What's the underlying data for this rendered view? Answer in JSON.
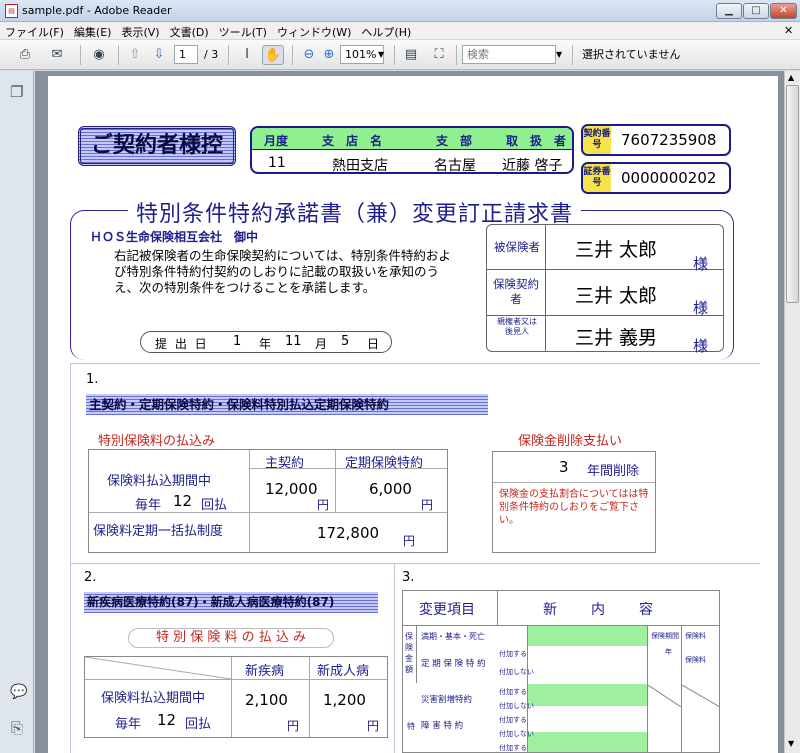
{
  "window": {
    "title": "sample.pdf - Adobe Reader",
    "min": "▁",
    "max": "□",
    "close": "✕"
  },
  "menu": [
    "ファイル(F)",
    "編集(E)",
    "表示(V)",
    "文書(D)",
    "ツール(T)",
    "ウィンドウ(W)",
    "ヘルプ(H)"
  ],
  "toolbar": {
    "page_current": "1",
    "page_total": "/ 3",
    "zoom": "101%",
    "search_placeholder": "検索",
    "status": "選択されていません"
  },
  "doc": {
    "copy_label": "ご契約者様控",
    "hdr": {
      "month": "月度",
      "branch": "支　店　名",
      "division": "支　部",
      "handler": "取　扱　者",
      "month_val": "11",
      "branch_val": "熱田支店",
      "division_val": "名古屋",
      "handler_val": "近藤 啓子"
    },
    "contract_no_label": "契約番号",
    "contract_no": "7607235908",
    "cert_no_label": "証券番号",
    "cert_no": "0000000202",
    "title": "特別条件特約承諾書（兼）変更訂正請求書",
    "company": "ＨＯＳ生命保険相互会社　御中",
    "intro": "右記被保険者の生命保険契約については、特別条件特約および特別条件特約付契約のしおりに記載の取扱いを承知のうえ、次の特別条件をつけることを承諾します。",
    "submit": {
      "label": "提 出 日",
      "y": "1",
      "y_u": "年",
      "m": "11",
      "m_u": "月",
      "d": "5",
      "d_u": "日"
    },
    "persons": [
      {
        "role": "被保険者",
        "name": "三井 太郎",
        "hon": "様"
      },
      {
        "role": "保険契約者",
        "name": "三井 太郎",
        "hon": "様"
      },
      {
        "role": "親権者又は後見人",
        "name": "三井 義男",
        "hon": "様"
      }
    ],
    "s1": {
      "num": "1.",
      "plan": "主契約・定期保険特約・保険料特別払込定期保険特約",
      "pay_title": "特別保険料の払込み",
      "col1": "主契約",
      "col2": "定期保険特約",
      "row1": "保険料払込期間中",
      "row1b": "毎年",
      "row1c": "12",
      "row1d": "回払",
      "v1": "12,000",
      "v2": "6,000",
      "yen": "円",
      "row2": "保険料定期一括払制度",
      "v3": "172,800",
      "del_title": "保険金削除支払い",
      "del_years": "3",
      "del_unit": "年間削除",
      "del_note": "保険金の支払割合についてはは特別条件特約のしおりをご覧下さい。"
    },
    "s2": {
      "num": "2.",
      "plan": "新疾病医療特約(87)・新成人病医療特約(87)",
      "pay_title": "特 別 保 険 料 の 払 込 み",
      "col1": "新疾病",
      "col2": "新成人病",
      "row1": "保険料払込期間中",
      "row1b": "毎年",
      "row1c": "12",
      "row1d": "回払",
      "v1": "2,100",
      "v2": "1,200",
      "yen": "円"
    },
    "s3": {
      "num": "3.",
      "h1": "変更項目",
      "h2": "新　　内　　容",
      "rows": [
        "満期・基本・死亡",
        "定 期 保 険 特 約",
        "災害割増特約",
        "障 害 特 約"
      ],
      "side": "保険金額",
      "opt_on": "付加する",
      "opt_off": "付加しない",
      "p1": "保険料",
      "p2": "保険料",
      "p3": "保険期間",
      "p4": "年"
    }
  }
}
